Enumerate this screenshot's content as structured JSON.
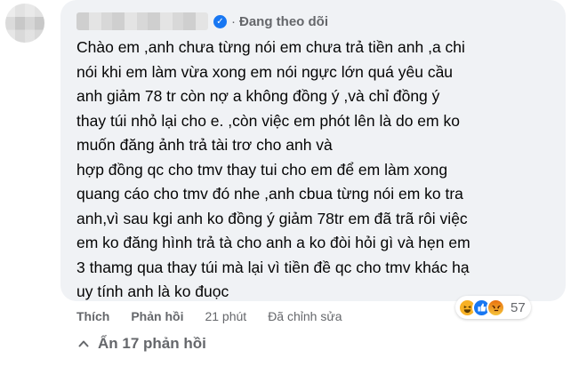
{
  "comment": {
    "follow_status": "Đang theo dõi",
    "separator": "·",
    "verified_mark": "✓",
    "lines": [
      "Chào em ,anh chưa từng nói em chưa trả tiền anh ,a chi",
      "nói khi em làm vừa xong em nói ngực lớn quá yêu cầu",
      "anh giảm 78 tr còn nợ a không đồng ý ,và chỉ đồng ý",
      "thay túi nhỏ lại cho e. ,còn việc em phót lên là do em ko",
      "muốn đăng ảnh trả tài trơ cho anh và",
      "hợp đồng qc cho tmv thay tui cho em để em làm xong",
      "quang cáo cho tmv đó nhe ,anh cbua từng nói em ko tra",
      "anh,vì sau kgi anh ko đồng ý giảm 78tr em đã trã rôi việc",
      "em ko đăng hình trả tà cho anh a ko đòi hỏi gì và hẹn em",
      "3 thamg qua thay túi mà lại vì tiền đề qc cho tmv khác hạ",
      "uy tính anh là ko đuọc"
    ],
    "reactions": {
      "icons": [
        "haha-icon",
        "like-icon",
        "angry-icon"
      ],
      "count": "57"
    },
    "actions": {
      "like_label": "Thích",
      "reply_label": "Phản hồi",
      "time": "21 phút",
      "edited": "Đã chỉnh sửa"
    },
    "replies_toggle": "Ẩn 17 phản hồi"
  },
  "colors": {
    "bubble": "#f0f2f5",
    "secondary_text": "#65676b",
    "verified": "#1877f2"
  }
}
